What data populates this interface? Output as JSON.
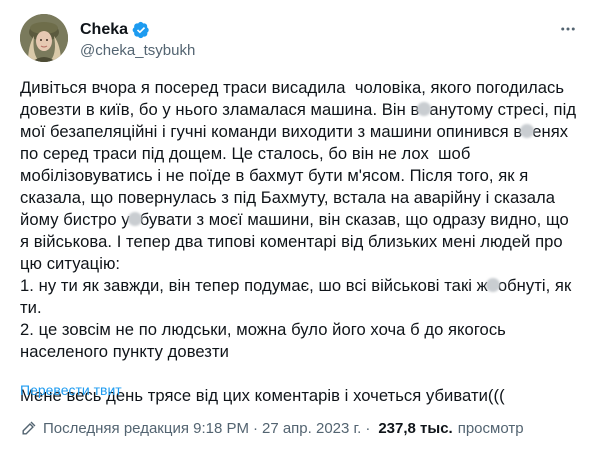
{
  "author": {
    "display_name": "Cheka",
    "handle": "@cheka_tsybukh",
    "verified_color": "#1d9bf0"
  },
  "tweet": {
    "lines": [
      "Дивіться вчора я посеред траси висадила  чоловіка, якого погодилась",
      "довезти в київ, бо у нього зламалася машина. Він в",
      "анутому стресі, під",
      "мої безапеляційні і гучні команди виходити з машини опинився в",
      "енях",
      "по серед траси під дощем. Це сталось, бо він не лох  шоб",
      "мобілізовуватись і не поїде в бахмут бути м'ясом. Після того, як я",
      "сказала, що повернулась з під Бахмуту, встала на аварійну і сказала",
      "йому бистро у",
      "бувати з моєї машини, він сказав, що одразу видно, що",
      "я військова. І тепер два типові коментарі від близьких мені людей про",
      "цю ситуацію:",
      "1. ну ти як завжди, він тепер подумає, шо всі військові такі ж",
      "обнуті, як",
      "ти.",
      "2. це зовсім не по людськи, можна було його хоча б до якогось",
      "населеного пункту довезти",
      "Мене весь день трясе від цих коментарів і хочеться убивати((("
    ]
  },
  "translate_label": "Перевести твит",
  "meta": {
    "edited_label": "Последняя редакция 9:18 PM",
    "separator": "·",
    "date": "27 апр. 2023 г.",
    "views_count": "237,8 тыс.",
    "views_label": "просмотр"
  },
  "icons": {
    "more": "more-horizontal-icon",
    "verified": "verified-badge-icon",
    "edit": "pencil-icon"
  }
}
